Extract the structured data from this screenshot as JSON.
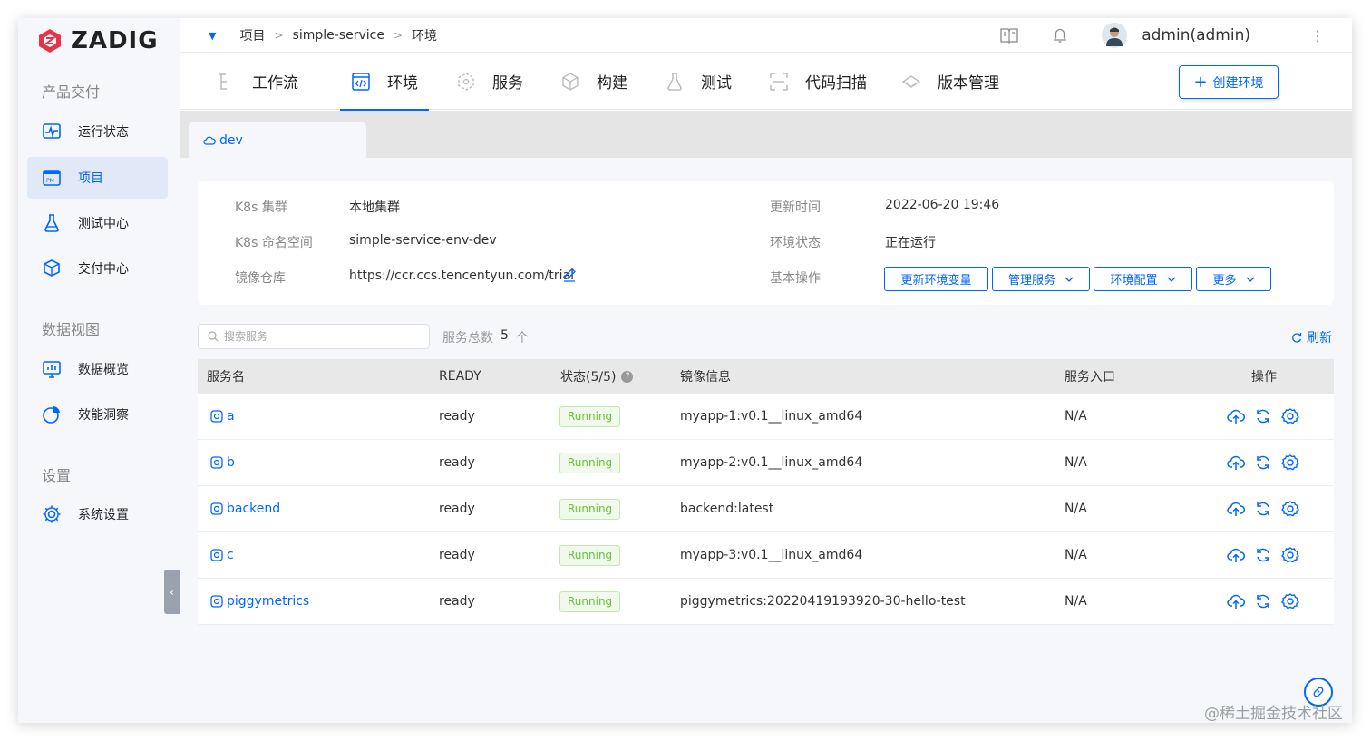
{
  "app": {
    "logo_text": "ZADIG"
  },
  "sidebar": {
    "sections": [
      {
        "title": "产品交付"
      },
      {
        "title": "数据视图"
      },
      {
        "title": "设置"
      }
    ],
    "items": [
      {
        "label": "运行状态",
        "icon": "pulse-monitor-icon"
      },
      {
        "label": "项目",
        "icon": "project-pm-icon",
        "active": true
      },
      {
        "label": "测试中心",
        "icon": "flask-icon"
      },
      {
        "label": "交付中心",
        "icon": "delivery-cube-icon"
      },
      {
        "label": "数据概览",
        "icon": "monitor-chart-icon"
      },
      {
        "label": "效能洞察",
        "icon": "pie-chart-icon"
      },
      {
        "label": "系统设置",
        "icon": "gear-icon"
      }
    ]
  },
  "breadcrumb": {
    "items": [
      "项目",
      "simple-service",
      "环境"
    ],
    "separator": ">"
  },
  "user": {
    "name": "admin(admin)"
  },
  "tabs": [
    {
      "label": "工作流",
      "icon": "workflow-icon"
    },
    {
      "label": "环境",
      "icon": "code-window-icon",
      "active": true
    },
    {
      "label": "服务",
      "icon": "hexagon-service-icon"
    },
    {
      "label": "构建",
      "icon": "cube-build-icon"
    },
    {
      "label": "测试",
      "icon": "flask-icon"
    },
    {
      "label": "代码扫描",
      "icon": "scan-icon"
    },
    {
      "label": "版本管理",
      "icon": "version-icon"
    }
  ],
  "create_env_button": "创建环境",
  "env_tab": {
    "label": "dev"
  },
  "info": {
    "cluster_label": "K8s 集群",
    "cluster_value": "本地集群",
    "namespace_label": "K8s 命名空间",
    "namespace_value": "simple-service-env-dev",
    "registry_label": "镜像仓库",
    "registry_value": "https://ccr.ccs.tencentyun.com/trial",
    "updated_label": "更新时间",
    "updated_value": "2022-06-20 19:46",
    "status_label": "环境状态",
    "status_value": "正在运行",
    "ops_label": "基本操作",
    "ops_buttons": [
      "更新环境变量",
      "管理服务",
      "环境配置",
      "更多"
    ]
  },
  "search": {
    "placeholder": "搜索服务"
  },
  "service_count": {
    "label": "服务总数",
    "value": "5",
    "unit": "个"
  },
  "refresh_label": "刷新",
  "table": {
    "headers": [
      "服务名",
      "READY",
      "状态(5/5)",
      "镜像信息",
      "服务入口",
      "操作"
    ],
    "rows": [
      {
        "name": "a",
        "ready": "ready",
        "status": "Running",
        "image": "myapp-1:v0.1__linux_amd64",
        "entry": "N/A"
      },
      {
        "name": "b",
        "ready": "ready",
        "status": "Running",
        "image": "myapp-2:v0.1__linux_amd64",
        "entry": "N/A"
      },
      {
        "name": "backend",
        "ready": "ready",
        "status": "Running",
        "image": "backend:latest",
        "entry": "N/A"
      },
      {
        "name": "c",
        "ready": "ready",
        "status": "Running",
        "image": "myapp-3:v0.1__linux_amd64",
        "entry": "N/A"
      },
      {
        "name": "piggymetrics",
        "ready": "ready",
        "status": "Running",
        "image": "piggymetrics:20220419193920-30-hello-test",
        "entry": "N/A"
      }
    ]
  },
  "watermark": "@稀土掘金技术社区",
  "colors": {
    "primary": "#0066ff",
    "success": "#67c23a",
    "sidebar_bg": "#f5f7fa"
  }
}
